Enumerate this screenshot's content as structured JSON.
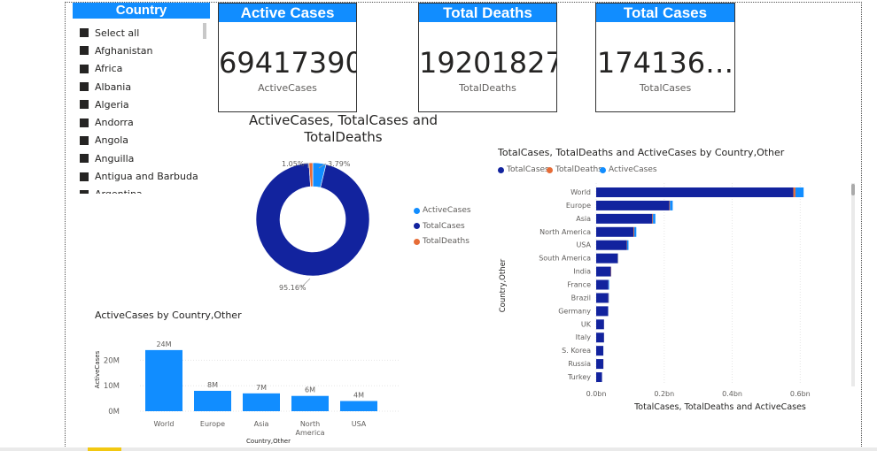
{
  "slicer": {
    "title": "Country",
    "items": [
      "Select all",
      "Afghanistan",
      "Africa",
      "Albania",
      "Algeria",
      "Andorra",
      "Angola",
      "Anguilla",
      "Antigua and Barbuda",
      "Argentina"
    ]
  },
  "cards": [
    {
      "title": "Active Cases",
      "value": "69417390",
      "label": "ActiveCases"
    },
    {
      "title": "Total Deaths",
      "value": "19201827",
      "label": "TotalDeaths"
    },
    {
      "title": "Total Cases",
      "value": "174136…",
      "label": "TotalCases"
    }
  ],
  "colors": {
    "active": "#118dff",
    "total": "#12239e",
    "deaths": "#e66c37",
    "header": "#118dff"
  },
  "chart_data": [
    {
      "type": "pie",
      "title": "ActiveCases, TotalCases and TotalDeaths",
      "labels": [
        "ActiveCases",
        "TotalCases",
        "TotalDeaths"
      ],
      "values": [
        3.79,
        95.16,
        1.05
      ],
      "data_labels": [
        "3.79%",
        "95.16%",
        "1.05%"
      ],
      "legend": [
        "ActiveCases",
        "TotalCases",
        "TotalDeaths"
      ],
      "legend_position": "right"
    },
    {
      "type": "bar",
      "orientation": "horizontal",
      "stacked": true,
      "title": "TotalCases, TotalDeaths and ActiveCases by Country,Other",
      "categories": [
        "World",
        "Europe",
        "Asia",
        "North America",
        "USA",
        "South America",
        "India",
        "France",
        "Brazil",
        "Germany",
        "UK",
        "Italy",
        "S. Korea",
        "Russia",
        "Turkey"
      ],
      "series": [
        {
          "name": "TotalCases",
          "values": [
            0.58,
            0.215,
            0.165,
            0.11,
            0.09,
            0.063,
            0.043,
            0.036,
            0.036,
            0.035,
            0.023,
            0.023,
            0.021,
            0.021,
            0.017
          ]
        },
        {
          "name": "TotalDeaths",
          "values": [
            0.006,
            0.002,
            0.002,
            0.002,
            0.001,
            0.001,
            0.001,
            0.0002,
            0.0007,
            0.0002,
            0.0002,
            0.0002,
            3e-05,
            0.0004,
            0.0001
          ]
        },
        {
          "name": "ActiveCases",
          "values": [
            0.024,
            0.008,
            0.007,
            0.006,
            0.004,
            0.001,
            0.0001,
            0.0018,
            0.0007,
            0.0004,
            0.0001,
            0.0001,
            0.0001,
            0.0001,
            0.0001
          ]
        }
      ],
      "xlabel": "TotalCases, TotalDeaths and ActiveCases",
      "ylabel": "Country,Other",
      "xticks": [
        "0.0bn",
        "0.2bn",
        "0.4bn",
        "0.6bn"
      ],
      "xlim": [
        0,
        0.62
      ],
      "legend_position": "top-left"
    },
    {
      "type": "bar",
      "title": "ActiveCases by Country,Other",
      "categories": [
        "World",
        "Europe",
        "Asia",
        "North America",
        "USA"
      ],
      "values": [
        24,
        8,
        7,
        6,
        4
      ],
      "data_labels": [
        "24M",
        "8M",
        "7M",
        "6M",
        "4M"
      ],
      "xlabel": "Country,Other",
      "ylabel": "ActiveCases",
      "yticks": [
        "0M",
        "10M",
        "20M"
      ],
      "ylim": [
        0,
        25
      ]
    }
  ]
}
